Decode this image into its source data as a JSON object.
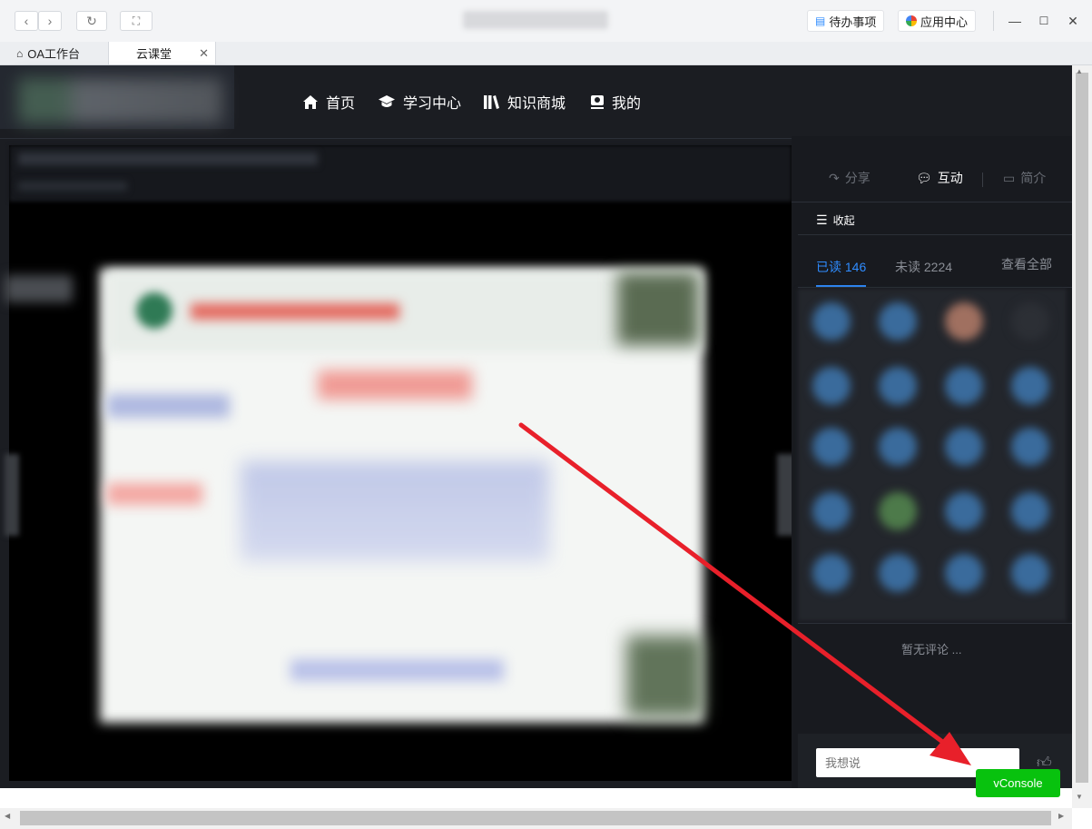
{
  "browser": {
    "toolbar": {
      "todo_label": "待办事项",
      "appcenter_label": "应用中心"
    },
    "tabs": [
      {
        "label": "OA工作台"
      },
      {
        "label": "云课堂"
      }
    ]
  },
  "app": {
    "nav": [
      {
        "label": "首页"
      },
      {
        "label": "学习中心"
      },
      {
        "label": "知识商城"
      },
      {
        "label": "我的"
      }
    ],
    "side_tabs": [
      {
        "label": "分享"
      },
      {
        "label": "互动"
      },
      {
        "label": "简介"
      }
    ],
    "collapse_label": "收起",
    "read_label": "已读 146",
    "unread_label": "未读 2224",
    "view_all_label": "查看全部",
    "no_comments": "暂无评论 ...",
    "comment_placeholder": "我想说",
    "vconsole_label": "vConsole"
  },
  "colors": {
    "accent": "#2f8cff",
    "vconsole": "#08c20e",
    "arrow": "#e8202a"
  }
}
